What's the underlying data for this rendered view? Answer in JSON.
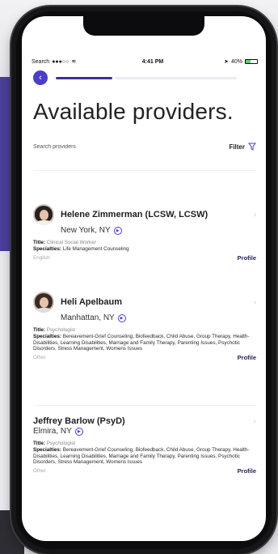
{
  "status_bar": {
    "carrier": "Search",
    "signal": "●●●○○",
    "time": "4:41 PM",
    "battery": "40%"
  },
  "page": {
    "title": "Available providers.",
    "search_placeholder": "Search providers",
    "filter_label": "Filter"
  },
  "labels": {
    "title": "Title:",
    "specialties": "Specialties:",
    "profile": "Profile"
  },
  "providers": [
    {
      "name": "Helene Zimmerman (LCSW, LCSW)",
      "location": "New York, NY",
      "title": "Clinical Social Worker",
      "specialties": "Life Management Counseling",
      "language": "English"
    },
    {
      "name": "Heli Apelbaum",
      "location": "Manhattan, NY",
      "title": "Psychologist",
      "specialties": "Bereavement-Grief Counseling, Biofeedback, Child Abuse, Group Therapy, Health-Disabilities, Learning Disabilities, Marriage and Family Therapy, Parenting Issues, Psychotic Disorders, Stress Management, Womens Issues",
      "language": "Other"
    },
    {
      "name": "Jeffrey  Barlow (PsyD)",
      "location": "Elmira, NY",
      "title": "Psychologist",
      "specialties": "Bereavement-Grief Counseling, Biofeedback, Child Abuse, Group Therapy, Health-Disabilities, Learning Disabilities, Marriage and Family Therapy, Parenting Issues, Psychotic Disorders, Stress Management, Womens Issues",
      "language": "Other"
    }
  ],
  "colors": {
    "accent": "#4b3ec7",
    "progress": "#3d2f9e",
    "profile_link": "#1f1f5a"
  },
  "icons": {
    "back": "arrow-left-icon",
    "filter": "funnel-icon",
    "video": "video-call-icon",
    "chevron": "chevron-right-icon"
  }
}
